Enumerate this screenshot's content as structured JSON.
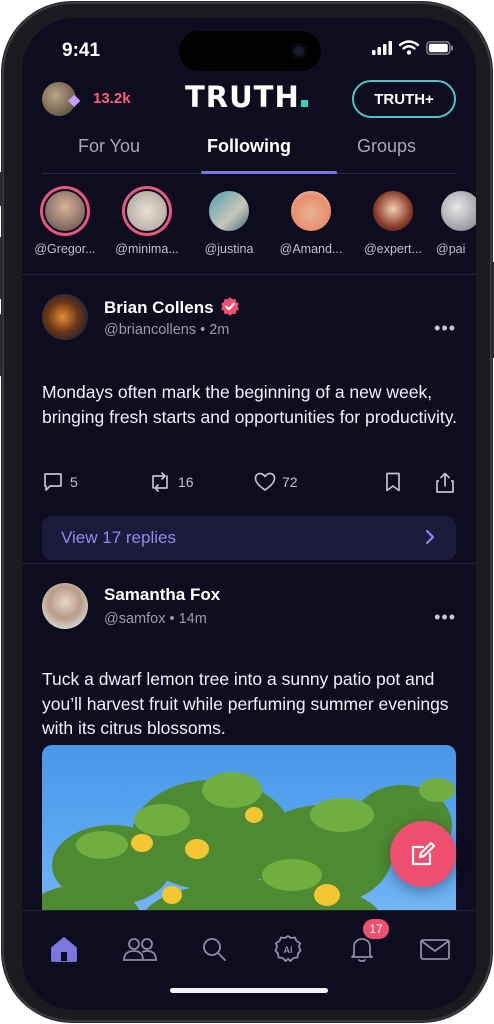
{
  "status_bar": {
    "time": "9:41"
  },
  "topbar": {
    "points": "13.2k",
    "logo": "TRUTH",
    "plus_button": "TRUTH+"
  },
  "tabs": [
    {
      "label": "For You",
      "active": false
    },
    {
      "label": "Following",
      "active": true
    },
    {
      "label": "Groups",
      "active": false
    }
  ],
  "stories": [
    {
      "name": "@Gregor...",
      "live": true
    },
    {
      "name": "@minima...",
      "live": true
    },
    {
      "name": "@justina",
      "live": false
    },
    {
      "name": "@Amand...",
      "live": false
    },
    {
      "name": "@expert...",
      "live": false
    },
    {
      "name": "@pai",
      "live": false
    }
  ],
  "posts": [
    {
      "name": "Brian Collens",
      "verified": true,
      "handle": "@briancollens • 2m",
      "body": "Mondays often mark the beginning of a new week, bringing fresh starts and opportunities for productivity.",
      "replies": "5",
      "retruths": "16",
      "likes": "72",
      "view_replies": "View 17 replies"
    },
    {
      "name": "Samantha Fox",
      "verified": false,
      "handle": "@samfox • 14m",
      "body": "Tuck a dwarf lemon tree into a sunny patio pot and you’ll harvest fruit while perfuming summer evenings with its citrus blossoms."
    }
  ],
  "bottom_nav": {
    "notifications_badge": "17"
  },
  "colors": {
    "background": "#0e0c1f",
    "accent": "#7c76e0",
    "pink": "#ef4f6e",
    "teal": "#4cc5c6"
  }
}
